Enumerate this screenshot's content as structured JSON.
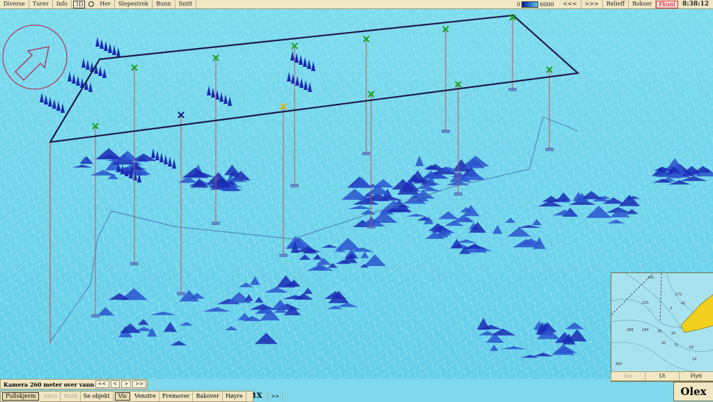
{
  "topbar": {
    "menus": [
      "Diverse",
      "Turer",
      "Info"
    ],
    "mode_3d": "3D",
    "menus2": [
      "Her",
      "Slepestrek",
      "Bunn",
      "Snitt"
    ],
    "scale_min": "0",
    "scale_max": "6000",
    "prev": "<<<",
    "next": ">>>",
    "relief": "Relieff",
    "bokser": "Bokser",
    "punkt": "Pkunt",
    "time": "8:38:12"
  },
  "camera": {
    "label": "Kamera 260 meter over vann",
    "btns": [
      "<<",
      "<",
      ">",
      ">>"
    ]
  },
  "bottombar": {
    "items": [
      {
        "label": "Fullskjerm",
        "state": "selected"
      },
      {
        "label": "Anso",
        "state": "disabled"
      },
      {
        "label": "Hold",
        "state": "disabled"
      },
      {
        "label": "Se objekt",
        "state": "normal"
      },
      {
        "label": "Vis",
        "state": "selected"
      },
      {
        "label": "Venstre",
        "state": "normal"
      },
      {
        "label": "Fremover",
        "state": "normal"
      },
      {
        "label": "Bakover",
        "state": "normal"
      },
      {
        "label": "Høyre",
        "state": "normal"
      }
    ],
    "zoom": "1X",
    "zoom_nav": ">>"
  },
  "minimap": {
    "buttons": [
      "Inn",
      "Ut",
      "Flytt"
    ],
    "depths": [
      "241",
      "223",
      "172",
      "42",
      "3",
      "288",
      "184",
      "35",
      "26",
      "45",
      "72",
      "62",
      "14",
      "400"
    ]
  },
  "logo": "Olex",
  "colors": {
    "marker_green": "#1aa11a",
    "marker_blue": "#141480",
    "marker_yellow": "#e0b000",
    "box": "#1e1a4a",
    "pole": "#d05050"
  }
}
